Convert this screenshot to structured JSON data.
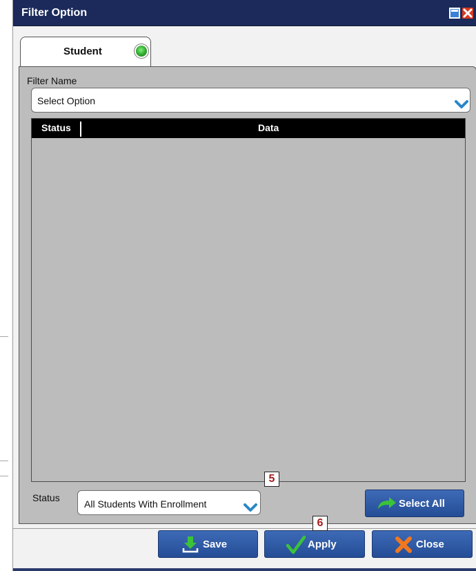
{
  "window": {
    "title": "Filter Option",
    "maximize_icon": "maximize-icon",
    "close_icon": "close-icon"
  },
  "tab": {
    "label": "Student",
    "status_indicator": "green-dot-icon",
    "status_color": "#2fa52c"
  },
  "filter": {
    "label": "Filter Name",
    "value": "Select Option"
  },
  "grid": {
    "columns": [
      "Status",
      "Data"
    ],
    "rows": []
  },
  "status": {
    "label": "Status",
    "value": "All Students With Enrollment"
  },
  "buttons": {
    "select_all": "Select All",
    "save": "Save",
    "apply": "Apply",
    "close": "Close"
  },
  "callouts": [
    "5",
    "6"
  ],
  "colors": {
    "titlebar": "#1b2a5a",
    "button": "#2f5ba6",
    "panel": "#bdbdbd",
    "chevron": "#2a86c8"
  }
}
